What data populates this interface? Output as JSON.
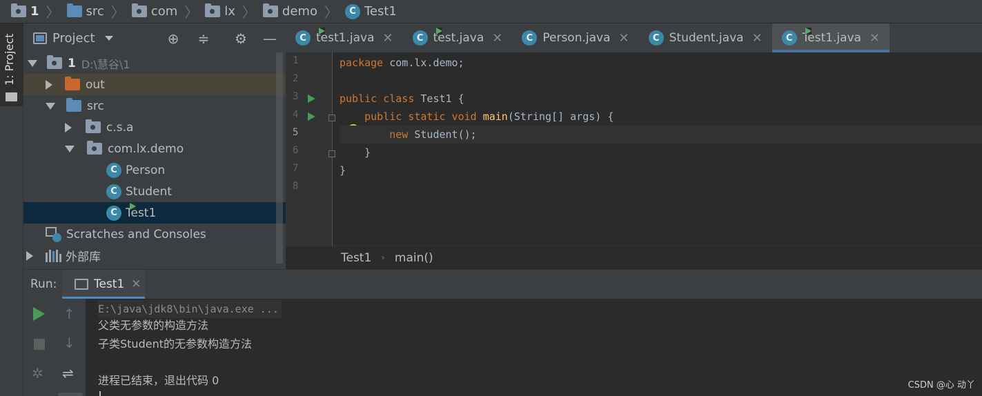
{
  "navbar": {
    "crumbs": [
      {
        "label": "1",
        "icon": "project-folder-icon"
      },
      {
        "label": "src",
        "icon": "source-folder-icon"
      },
      {
        "label": "com",
        "icon": "package-icon"
      },
      {
        "label": "lx",
        "icon": "package-icon"
      },
      {
        "label": "demo",
        "icon": "package-icon"
      },
      {
        "label": "Test1",
        "icon": "class-icon"
      }
    ]
  },
  "strip": {
    "project_tab": "1: Project"
  },
  "project": {
    "title": "Project",
    "tree": {
      "root": {
        "label": "1",
        "path": "D:\\慧谷\\1"
      },
      "out": "out",
      "src": "src",
      "pkg1": "c.s.a",
      "pkg2": "com.lx.demo",
      "cls_person": "Person",
      "cls_student": "Student",
      "cls_test1": "Test1",
      "scratches": "Scratches and Consoles",
      "libs": "外部库"
    }
  },
  "editor": {
    "tabs": [
      {
        "label": "test1.java"
      },
      {
        "label": "test.java"
      },
      {
        "label": "Person.java"
      },
      {
        "label": "Student.java"
      },
      {
        "label": "Test1.java",
        "active": true
      }
    ],
    "line_numbers": [
      "1",
      "2",
      "3",
      "4",
      "5",
      "6",
      "7",
      "8"
    ],
    "code": {
      "l1_kw": "package",
      "l1_rest": " com.lx.demo;",
      "l3_kw": "public class",
      "l3_rest": " Test1 {",
      "l4_kw": "    public static void",
      "l4_fn": " main",
      "l4_rest": "(String[] args) {",
      "l5_kw": "        new",
      "l5_rest": " Student();",
      "l6": "    }",
      "l7": "}"
    },
    "breadcrumb": {
      "cls": "Test1",
      "method": "main()"
    }
  },
  "run": {
    "label": "Run:",
    "tab": "Test1",
    "console": {
      "cmd": "E:\\java\\jdk8\\bin\\java.exe ...",
      "out1": "父类无参数的构造方法",
      "out2": "子类Student的无参数构造方法",
      "exit": "进程已结束，退出代码 0"
    }
  },
  "watermark": "CSDN @心 动丫",
  "colors": {
    "keyword": "#cc7832",
    "function": "#ffc66d",
    "text": "#a9b7c6",
    "selection": "#0d293e",
    "accent": "#4a88c7"
  }
}
